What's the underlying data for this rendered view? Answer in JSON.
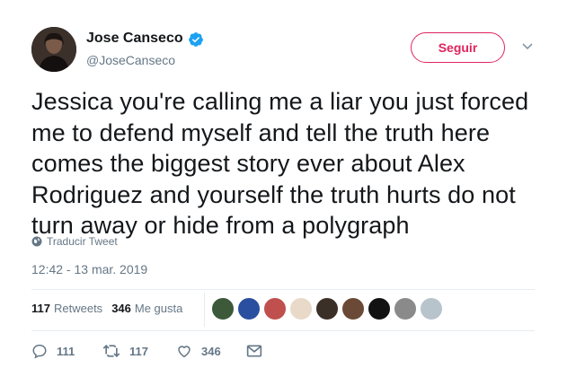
{
  "user": {
    "name": "Jose Canseco",
    "handle": "@JoseCanseco",
    "verified": true
  },
  "follow_label": "Seguir",
  "tweet": {
    "text": "Jessica you're calling me a liar you just forced me to defend myself and tell the truth here comes the biggest story ever about Alex Rodriguez and yourself the truth hurts do not turn away or hide from a polygraph",
    "translate_label": "Traducir Tweet",
    "timestamp": "12:42 - 13 mar. 2019"
  },
  "stats": {
    "retweets_count": "117",
    "retweets_label": "Retweets",
    "likes_count": "346",
    "likes_label": "Me gusta"
  },
  "facepile_colors": [
    "#3c5a3a",
    "#2b4fa0",
    "#c0504d",
    "#e8d9c8",
    "#3a3028",
    "#6a4a36",
    "#121212",
    "#8a8a8a",
    "#b8c4cc"
  ],
  "actions": {
    "replies": "111",
    "retweets": "117",
    "likes": "346"
  },
  "colors": {
    "accent": "#e0245e",
    "verified": "#1da1f2",
    "secondary_text": "#657786"
  }
}
